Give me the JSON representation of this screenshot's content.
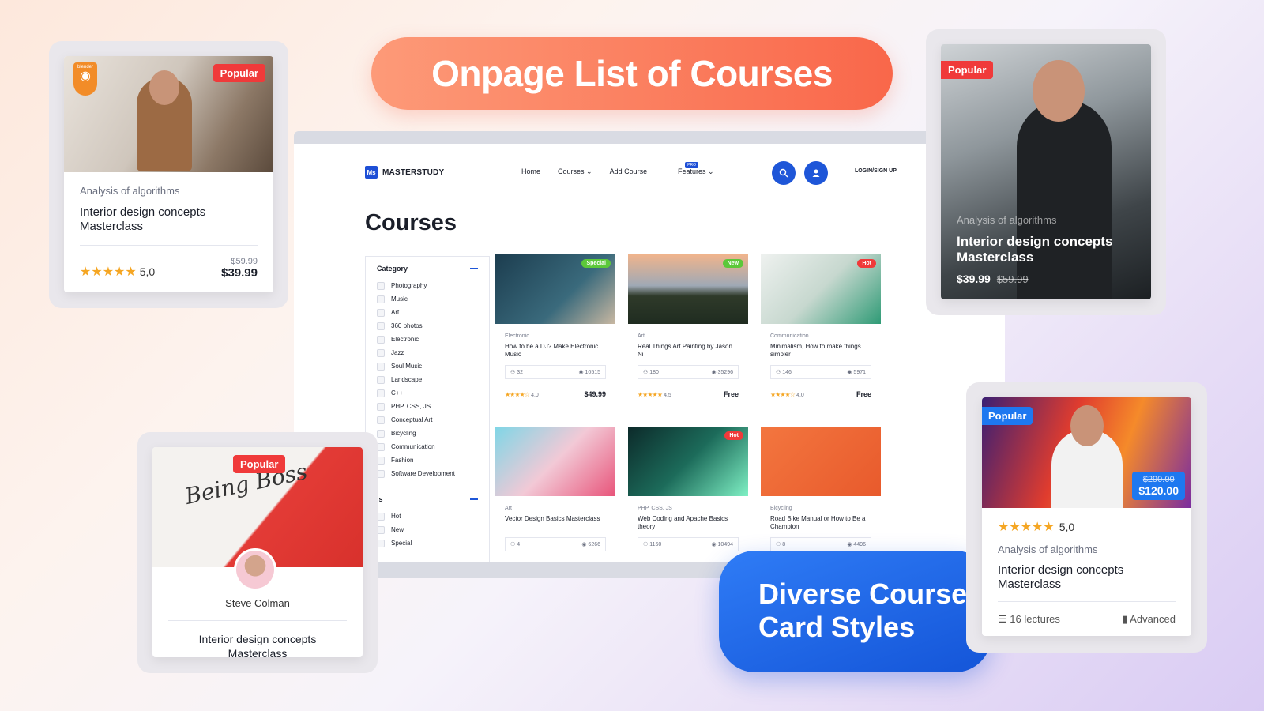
{
  "hero": {
    "title": "Onpage List of Courses"
  },
  "promo": {
    "line1": "Diverse Course",
    "line2": "Card Styles"
  },
  "site": {
    "logo_mark": "Ms",
    "logo_text": "MASTERSTUDY",
    "nav": {
      "home": "Home",
      "courses": "Courses",
      "add_course": "Add Course",
      "pro": "PRO",
      "features": "Features"
    },
    "login": "LOGIN/SIGN UP",
    "page_title": "Courses",
    "sidebar": {
      "category_head": "Category",
      "categories": [
        "Photography",
        "Music",
        "Art",
        "360 photos",
        "Electronic",
        "Jazz",
        "Soul Music",
        "Landscape",
        "C++",
        "PHP, CSS, JS",
        "Conceptual Art",
        "Bicycling",
        "Communication",
        "Fashion",
        "Software Development"
      ],
      "status_head": "tatus",
      "statuses": [
        "Hot",
        "New",
        "Special"
      ]
    },
    "courses": [
      {
        "badge": "Special",
        "badge_color": "#5cc83a",
        "category": "Electronic",
        "title": "How to be a DJ? Make Electronic Music",
        "students": "32",
        "views": "10515",
        "rating": "4.0",
        "price": "$49.99",
        "stars": "★★★★☆"
      },
      {
        "badge": "New",
        "badge_color": "#5cc83a",
        "category": "Art",
        "title": "Real Things Art Painting by Jason Ni",
        "students": "180",
        "views": "35296",
        "rating": "4.5",
        "price": "Free",
        "stars": "★★★★★"
      },
      {
        "badge": "Hot",
        "badge_color": "#f03a3a",
        "category": "Communication",
        "title": "Minimalism, How to make things simpler",
        "students": "146",
        "views": "5971",
        "rating": "4.0",
        "price": "Free",
        "stars": "★★★★☆"
      },
      {
        "badge": "",
        "badge_color": "",
        "category": "Art",
        "title": "Vector Design Basics Masterclass",
        "students": "4",
        "views": "6266"
      },
      {
        "badge": "Hot",
        "badge_color": "#f03a3a",
        "category": "PHP, CSS, JS",
        "title": "Web Coding and Apache Basics theory",
        "students": "1160",
        "views": "10494"
      },
      {
        "badge": "",
        "badge_color": "",
        "category": "Bicycling",
        "title": "Road Bike Manual or How to Be a Champion",
        "students": "8",
        "views": "4496"
      }
    ]
  },
  "card_a": {
    "badge": "Popular",
    "brand": "blender",
    "category": "Analysis of algorithms",
    "title": "Interior design concepts Masterclass",
    "rating": "5,0",
    "old_price": "$59.99",
    "price": "$39.99",
    "stars": "★★★★★"
  },
  "card_b": {
    "badge": "Popular",
    "category": "Analysis of algorithms",
    "title": "Interior design concepts Masterclass",
    "price": "$39.99",
    "old_price": "$59.99"
  },
  "card_c": {
    "badge": "Popular",
    "author": "Steve Colman",
    "title": "Interior design concepts Masterclass"
  },
  "card_d": {
    "badge": "Popular",
    "old_price": "$290.00",
    "price": "$120.00",
    "rating": "5,0",
    "stars": "★★★★★",
    "category": "Analysis of algorithms",
    "title": "Interior design concepts Masterclass",
    "lectures": "16 lectures",
    "level": "Advanced"
  }
}
